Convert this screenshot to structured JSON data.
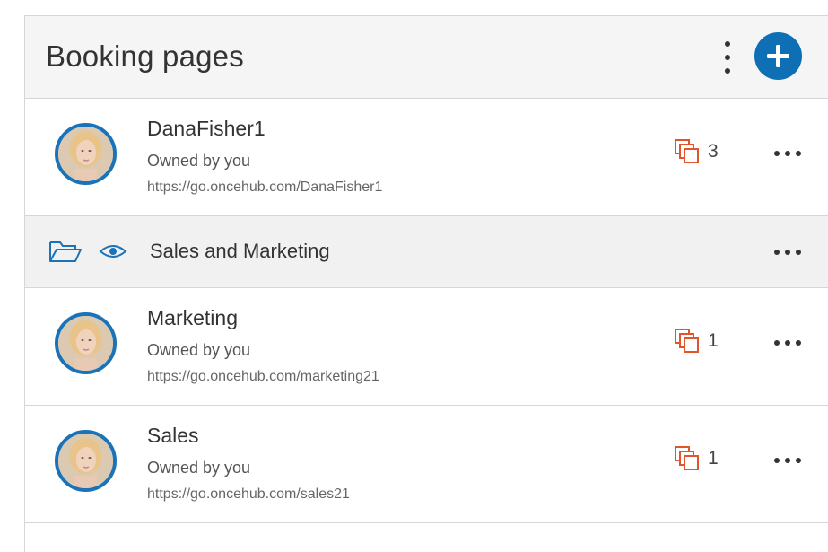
{
  "header": {
    "title": "Booking pages"
  },
  "booking_pages": [
    {
      "name": "DanaFisher1",
      "owner": "Owned by you",
      "url": "https://go.oncehub.com/DanaFisher1",
      "count": "3"
    },
    {
      "name": "Marketing",
      "owner": "Owned by you",
      "url": "https://go.oncehub.com/marketing21",
      "count": "1"
    },
    {
      "name": "Sales",
      "owner": "Owned by you",
      "url": "https://go.oncehub.com/sales21",
      "count": "1"
    }
  ],
  "folder": {
    "name": "Sales and Marketing"
  },
  "colors": {
    "accent": "#0f6fb4",
    "count_icon": "#e0552b",
    "folder_icon": "#1a73b8"
  },
  "icons": {
    "add": "plus-icon",
    "kebab": "kebab-icon",
    "more": "more-horizontal-icon",
    "count": "copy-pages-icon",
    "folder": "folder-open-icon",
    "visibility": "eye-icon"
  }
}
